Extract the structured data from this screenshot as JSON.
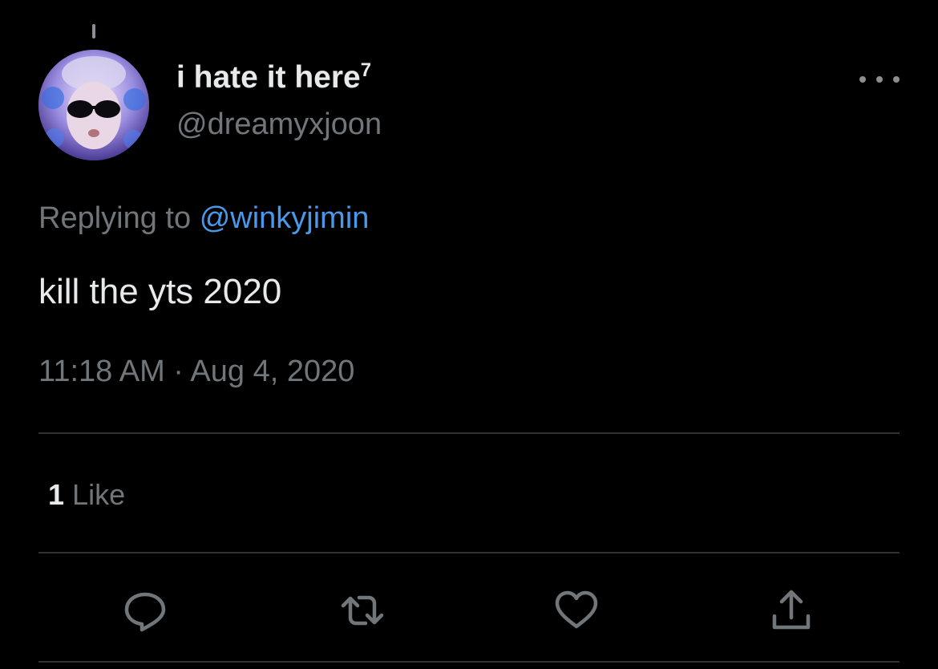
{
  "tweet": {
    "display_name": "i hate it here",
    "display_name_superscript": "7",
    "handle": "@dreamyxjoon",
    "replying_prefix": "Replying to",
    "replying_to": "@winkyjimin",
    "text": "kill the yts 2020",
    "timestamp": "11:18 AM · Aug 4, 2020"
  },
  "stats": {
    "likes_count": "1",
    "likes_label": "Like"
  },
  "actions": {
    "icons": [
      "reply-icon",
      "retweet-icon",
      "like-icon",
      "share-icon"
    ]
  },
  "colors": {
    "background": "#000000",
    "primary_text": "#e7e9ea",
    "secondary_text": "#71767b",
    "link": "#4a99e9",
    "divider": "#2f3336"
  }
}
